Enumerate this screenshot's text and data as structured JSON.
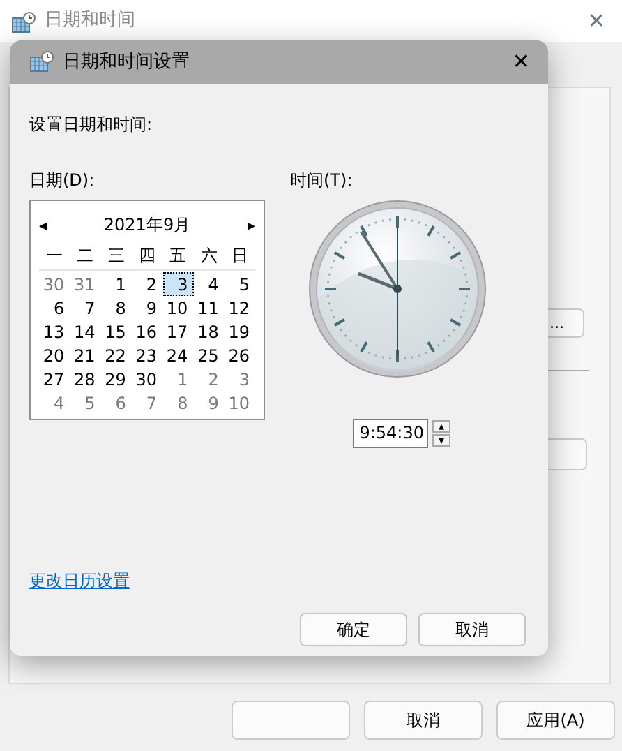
{
  "window": {
    "title": "日期和时间",
    "close": "✕"
  },
  "background_panel": {
    "button_text": "..."
  },
  "background_buttons": [
    {
      "label": "取消"
    },
    {
      "label": "应用(A)"
    }
  ],
  "dialog": {
    "title": "日期和时间设置",
    "close": "✕",
    "heading": "设置日期和时间:",
    "date_label": "日期(D):",
    "time_label": "时间(T):",
    "calendar": {
      "prev": "◂",
      "next": "▸",
      "month": "2021年9月",
      "weekdays": [
        "一",
        "二",
        "三",
        "四",
        "五",
        "六",
        "日"
      ],
      "days": [
        {
          "text": "30",
          "muted": true,
          "selected": false
        },
        {
          "text": "31",
          "muted": true,
          "selected": false
        },
        {
          "text": "1",
          "muted": false,
          "selected": false
        },
        {
          "text": "2",
          "muted": false,
          "selected": false
        },
        {
          "text": "3",
          "muted": false,
          "selected": true
        },
        {
          "text": "4",
          "muted": false,
          "selected": false
        },
        {
          "text": "5",
          "muted": false,
          "selected": false
        },
        {
          "text": "6",
          "muted": false,
          "selected": false
        },
        {
          "text": "7",
          "muted": false,
          "selected": false
        },
        {
          "text": "8",
          "muted": false,
          "selected": false
        },
        {
          "text": "9",
          "muted": false,
          "selected": false
        },
        {
          "text": "10",
          "muted": false,
          "selected": false
        },
        {
          "text": "11",
          "muted": false,
          "selected": false
        },
        {
          "text": "12",
          "muted": false,
          "selected": false
        },
        {
          "text": "13",
          "muted": false,
          "selected": false
        },
        {
          "text": "14",
          "muted": false,
          "selected": false
        },
        {
          "text": "15",
          "muted": false,
          "selected": false
        },
        {
          "text": "16",
          "muted": false,
          "selected": false
        },
        {
          "text": "17",
          "muted": false,
          "selected": false
        },
        {
          "text": "18",
          "muted": false,
          "selected": false
        },
        {
          "text": "19",
          "muted": false,
          "selected": false
        },
        {
          "text": "20",
          "muted": false,
          "selected": false
        },
        {
          "text": "21",
          "muted": false,
          "selected": false
        },
        {
          "text": "22",
          "muted": false,
          "selected": false
        },
        {
          "text": "23",
          "muted": false,
          "selected": false
        },
        {
          "text": "24",
          "muted": false,
          "selected": false
        },
        {
          "text": "25",
          "muted": false,
          "selected": false
        },
        {
          "text": "26",
          "muted": false,
          "selected": false
        },
        {
          "text": "27",
          "muted": false,
          "selected": false
        },
        {
          "text": "28",
          "muted": false,
          "selected": false
        },
        {
          "text": "29",
          "muted": false,
          "selected": false
        },
        {
          "text": "30",
          "muted": false,
          "selected": false
        },
        {
          "text": "1",
          "muted": true,
          "selected": false
        },
        {
          "text": "2",
          "muted": true,
          "selected": false
        },
        {
          "text": "3",
          "muted": true,
          "selected": false
        },
        {
          "text": "4",
          "muted": true,
          "selected": false
        },
        {
          "text": "5",
          "muted": true,
          "selected": false
        },
        {
          "text": "6",
          "muted": true,
          "selected": false
        },
        {
          "text": "7",
          "muted": true,
          "selected": false
        },
        {
          "text": "8",
          "muted": true,
          "selected": false
        },
        {
          "text": "9",
          "muted": true,
          "selected": false
        },
        {
          "text": "10",
          "muted": true,
          "selected": false
        }
      ]
    },
    "time_value": "9:54:30",
    "spin_up": "▴",
    "spin_down": "▾",
    "link": "更改日历设置",
    "buttons": [
      "确定",
      "取消"
    ]
  }
}
